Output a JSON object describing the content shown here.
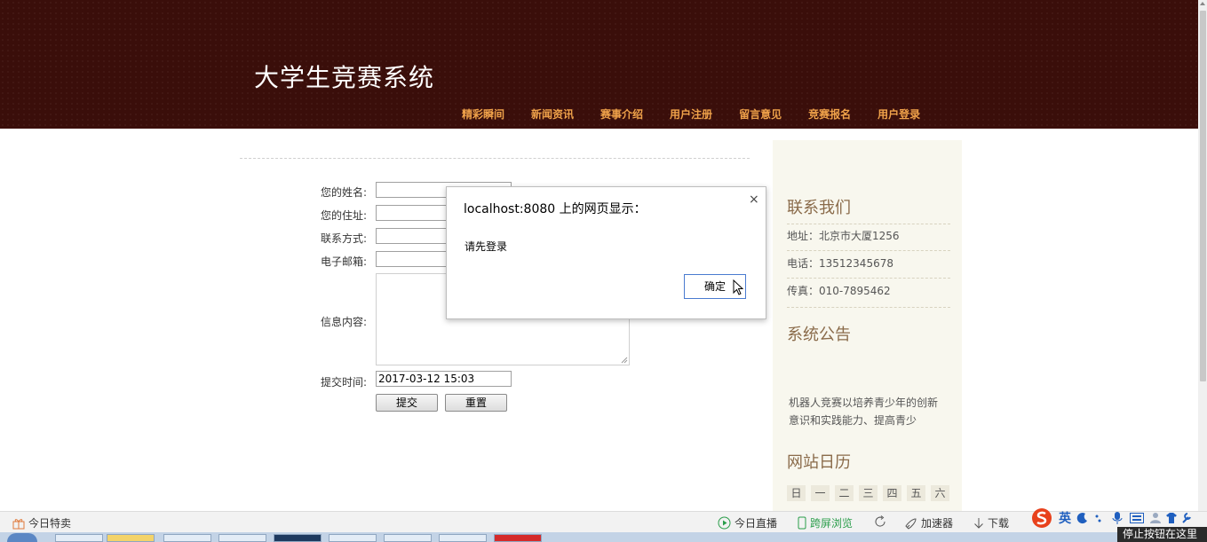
{
  "site": {
    "title": "大学生竞赛系统"
  },
  "nav": [
    "精彩瞬间",
    "新闻资讯",
    "赛事介绍",
    "用户注册",
    "留言意见",
    "竞赛报名",
    "用户登录"
  ],
  "form": {
    "name_label": "您的姓名:",
    "address_label": "您的住址:",
    "contact_label": "联系方式:",
    "email_label": "电子邮箱:",
    "content_label": "信息内容:",
    "time_label": "提交时间:",
    "time_value": "2017-03-12 15:03",
    "submit_label": "提交",
    "reset_label": "重置"
  },
  "sidebar": {
    "contact_heading": "联系我们",
    "address": "地址：北京市大厦1256",
    "phone": "电话：13512345678",
    "fax": "传真：010-7895462",
    "notice_heading": "系统公告",
    "notice_text": "机器人竞赛以培养青少年的创新意识和实践能力、提高青少",
    "calendar_heading": "网站日历",
    "calendar_days": [
      "日",
      "一",
      "二",
      "三",
      "四",
      "五",
      "六"
    ]
  },
  "dialog": {
    "title": "localhost:8080 上的网页显示：",
    "message": "请先登录",
    "ok_label": "确定",
    "close_symbol": "×"
  },
  "statusbar": {
    "today_deals": "今日特卖",
    "live": "今日直播",
    "cross_screen": "跨屏浏览",
    "accelerator": "加速器",
    "download": "下载",
    "ime_lang": "英"
  },
  "tooltip": "停止按钮在这里",
  "colors": {
    "header_bg": "#3a0e0a",
    "nav_text": "#f0a24a",
    "sidebar_bg": "#f8f7ee",
    "heading": "#8a6b4a"
  }
}
